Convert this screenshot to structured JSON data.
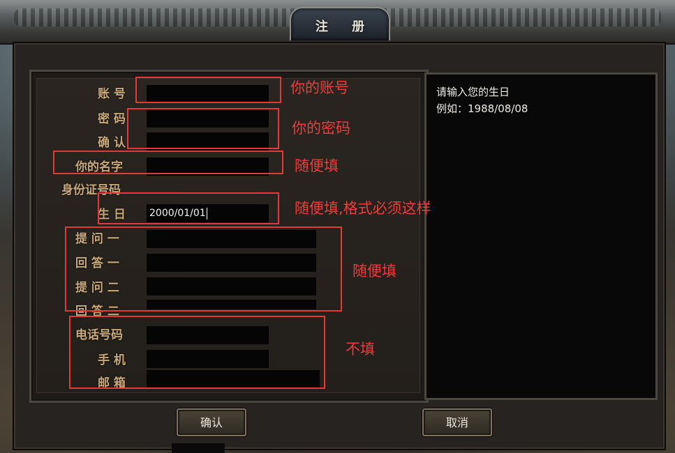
{
  "window": {
    "title": "注 册"
  },
  "form": {
    "labels": {
      "account": "账  号",
      "password": "密  码",
      "confirm": "确  认",
      "name": "你的名字",
      "id_number": "身份证号码",
      "birthday": "生  日",
      "question1": "提 问 一",
      "answer1": "回 答 一",
      "question2": "提 问 二",
      "answer2": "回 答 二",
      "phone": "电话号码",
      "mobile": "手  机",
      "email": "邮  箱"
    },
    "values": {
      "birthday": "2000/01/01"
    }
  },
  "info": {
    "line1": "请输入您的生日",
    "line2": "例如：1988/08/08"
  },
  "annotations": {
    "account": "你的账号",
    "password": "你的密码",
    "name": "随便填",
    "birthday": "随便填,格式必须这样",
    "questions": "随便填",
    "contact": "不填"
  },
  "buttons": {
    "ok": "确认",
    "cancel": "取消"
  }
}
